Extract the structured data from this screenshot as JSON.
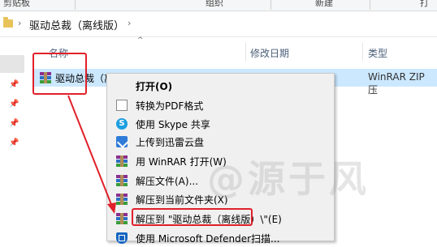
{
  "ribbon": {
    "groups": [
      "剪贴板",
      "组织",
      "新建",
      "打开"
    ]
  },
  "address": {
    "path": "驱动总裁（离线版）"
  },
  "columns": {
    "name": "名称",
    "modified": "修改日期",
    "type": "类型"
  },
  "file": {
    "name": "驱动总裁（离线版）",
    "type": "WinRAR ZIP 压"
  },
  "context_menu": {
    "items": [
      {
        "label": "打开(O)",
        "icon": "none"
      },
      {
        "label": "转换为PDF格式",
        "icon": "pdf-icon"
      },
      {
        "label": "使用 Skype 共享",
        "icon": "skype-icon"
      },
      {
        "label": "上传到迅雷云盘",
        "icon": "xunlei-icon"
      },
      {
        "label": "用 WinRAR 打开(W)",
        "icon": "winrar-icon"
      },
      {
        "label": "解压文件(A)...",
        "icon": "winrar-icon"
      },
      {
        "label": "解压到当前文件夹(X)",
        "icon": "winrar-icon"
      },
      {
        "label": "解压到 \"驱动总裁（离线版）\\\"(E)",
        "icon": "winrar-icon"
      },
      {
        "label": "使用 Microsoft Defender扫描...",
        "icon": "defender-icon"
      }
    ]
  },
  "watermark": "@源于风",
  "colors": {
    "selection": "#cce8ff",
    "annotation": "#e0202a",
    "menu_bg": "#f0f0f0"
  }
}
